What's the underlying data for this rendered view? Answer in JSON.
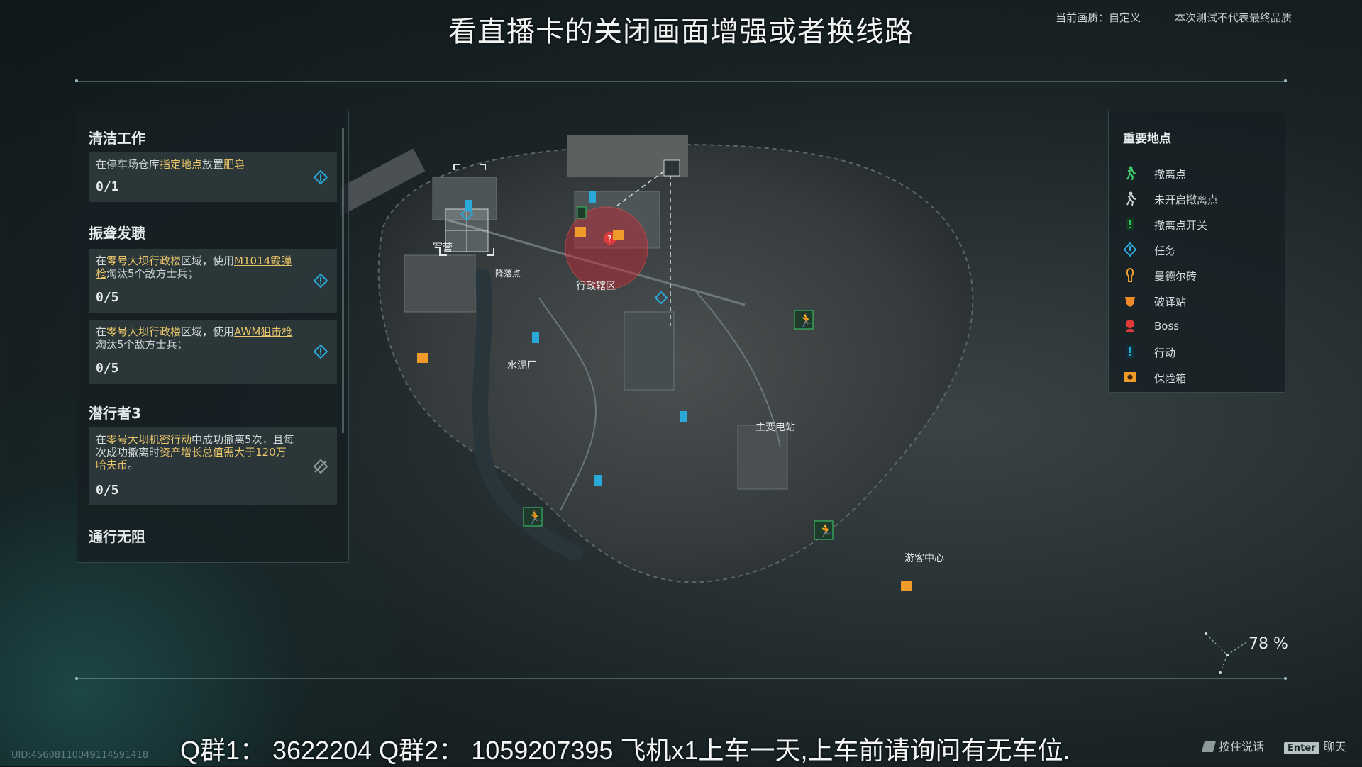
{
  "overlay": {
    "top_caption": "看直播卡的关闭画面增强或者换线路",
    "footer_caption": "Q群1： 3622204    Q群2： 1059207395     飞机x1上车一天,上车前请询问有无车位."
  },
  "header": {
    "quality_label": "当前画质：自定义",
    "test_notice": "本次测试不代表最终品质"
  },
  "tasks": {
    "groups": [
      {
        "title": "清洁工作",
        "items": [
          {
            "desc_a": "在停车场仓库",
            "desc_b": "指定地点",
            "desc_c": "放置",
            "desc_d": "肥皂",
            "progress": "0/1",
            "icon": "mission-diamond-icon"
          }
        ]
      },
      {
        "title": "振聋发聩",
        "items": [
          {
            "desc_a": "在",
            "desc_b": "零号大坝行政楼",
            "desc_c": "区域，使用",
            "desc_d": "M1014霰弹枪",
            "desc_e": "淘汰5个敌方士兵；",
            "progress": "0/5",
            "icon": "mission-diamond-icon"
          },
          {
            "desc_a": "在",
            "desc_b": "零号大坝行政楼",
            "desc_c": "区域，使用",
            "desc_d": "AWM狙击枪",
            "desc_e": "淘汰5个敌方士兵；",
            "progress": "0/5",
            "icon": "mission-diamond-icon"
          }
        ]
      },
      {
        "title": "潜行者3",
        "items": [
          {
            "desc_a": "在",
            "desc_b": "零号大坝机密行动",
            "desc_c": "中成功撤离5次，且每次成功撤离时",
            "desc_d": "资产增长总值需大于120万哈夫币",
            "desc_e": "。",
            "progress": "0/5",
            "icon": "locked-mission-icon"
          }
        ]
      },
      {
        "title": "通行无阻",
        "items": []
      }
    ]
  },
  "map": {
    "labels": {
      "barracks": "军营",
      "drop_point": "降落点",
      "admin_area": "行政辖区",
      "cement_plant": "水泥厂",
      "substation": "主变电站",
      "visitor_center": "游客中心"
    }
  },
  "legend": {
    "title": "重要地点",
    "items": [
      {
        "label": "撤离点",
        "icon": "extract-point-icon",
        "color": "#3fd06a"
      },
      {
        "label": "未开启撤离点",
        "icon": "extract-closed-icon",
        "color": "#c9d0d0"
      },
      {
        "label": "撤离点开关",
        "icon": "extract-switch-icon",
        "color": "#2ec45a"
      },
      {
        "label": "任务",
        "icon": "mission-diamond-icon",
        "color": "#2aa8d8"
      },
      {
        "label": "曼德尔砖",
        "icon": "mandel-brick-icon",
        "color": "#f0a030"
      },
      {
        "label": "破译站",
        "icon": "decrypt-station-icon",
        "color": "#f08a28"
      },
      {
        "label": "Boss",
        "icon": "boss-icon",
        "color": "#e23a3a"
      },
      {
        "label": "行动",
        "icon": "action-icon",
        "color": "#2aa8d8"
      },
      {
        "label": "保险箱",
        "icon": "safe-icon",
        "color": "#f09a2a"
      }
    ]
  },
  "zoom_percent": "78 %",
  "uid": "UID:4560811004911459141​8",
  "hints": {
    "voice": "按住说话",
    "enter_key": "Enter",
    "chat": "聊天"
  }
}
